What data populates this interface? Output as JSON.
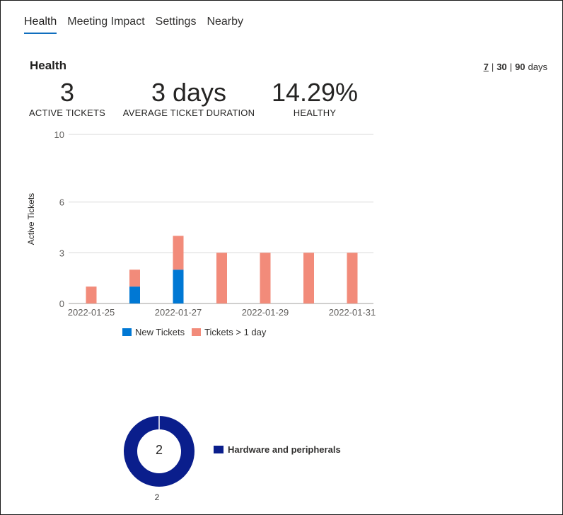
{
  "tabs": [
    {
      "label": "Health",
      "active": true
    },
    {
      "label": "Meeting Impact",
      "active": false
    },
    {
      "label": "Settings",
      "active": false
    },
    {
      "label": "Nearby",
      "active": false
    }
  ],
  "section_title": "Health",
  "range": {
    "options": [
      "7",
      "30",
      "90"
    ],
    "selected": "7",
    "unit": "days"
  },
  "stats": [
    {
      "value": "3",
      "label": "ACTIVE TICKETS"
    },
    {
      "value": "3 days",
      "label": "AVERAGE TICKET DURATION"
    },
    {
      "value": "14.29%",
      "label": "HEALTHY"
    }
  ],
  "colors": {
    "accent": "#106ebe",
    "new_tickets": "#0078d4",
    "old_tickets": "#f28b7a",
    "donut": "#0a1e8c"
  },
  "chart_data": [
    {
      "type": "bar",
      "stacked": true,
      "ylabel": "Active Tickets",
      "xlabel": "",
      "ylim": [
        0,
        10
      ],
      "yticks": [
        0,
        3,
        6,
        10
      ],
      "x_tick_labels": [
        "2022-01-25",
        "2022-01-27",
        "2022-01-29",
        "2022-01-31"
      ],
      "categories": [
        "2022-01-25",
        "2022-01-26",
        "2022-01-27",
        "2022-01-28",
        "2022-01-29",
        "2022-01-30",
        "2022-01-31"
      ],
      "series": [
        {
          "name": "New Tickets",
          "values": [
            0,
            1,
            2,
            0,
            0,
            0,
            0
          ]
        },
        {
          "name": "Tickets > 1 day",
          "values": [
            1,
            1,
            2,
            3,
            3,
            3,
            3
          ]
        }
      ],
      "legend": "bottom",
      "grid": true
    },
    {
      "type": "pie",
      "donut": true,
      "center_label": "2",
      "below_label": "2",
      "slices": [
        {
          "name": "Hardware and peripherals",
          "value": 2
        }
      ],
      "legend": "right"
    }
  ]
}
